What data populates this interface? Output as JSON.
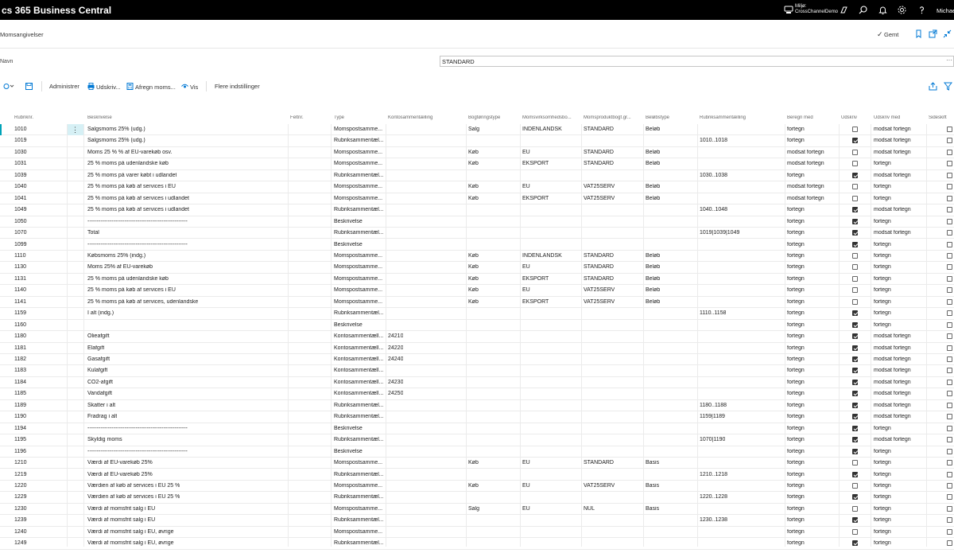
{
  "topbar": {
    "app_title": "cs 365 Business Central",
    "environment_label": "Miljø:",
    "environment_name": "CrossChannelDemo",
    "user_name": "Michae"
  },
  "page": {
    "title": "Momsangivelser",
    "saved_label": "Gemt",
    "name_label": "Navn",
    "name_value": "STANDARD"
  },
  "actions": {
    "administrer": "Administrer",
    "udskriv": "Udskriv...",
    "afregn_moms": "Afregn moms...",
    "vis": "Vis",
    "flere_indstillinger": "Flere indstillinger"
  },
  "columns": [
    "Rubriknr.",
    "Beskrivelse",
    "Feltnr.",
    "Type",
    "Kontosammentælling",
    "Bogføringstype",
    "Momsvirksomhedsbo...",
    "Momsproduktbogf.gr...",
    "Beløbstype",
    "Rubriksammentælling",
    "Beregn med",
    "Udskriv",
    "Udskriv med",
    "Sideskift"
  ],
  "rows": [
    {
      "nr": "1010",
      "desc": "Salgsmoms 25% (udg.)",
      "type": "Momspostsamme...",
      "konto": "",
      "bogf": "Salg",
      "virk": "INDENLANDSK",
      "prod": "STANDARD",
      "belob": "Beløb",
      "rubrik": "",
      "beregn": "fortegn",
      "udskriv": false,
      "udskrivmed": "modsat fortegn",
      "sideskift": false
    },
    {
      "nr": "1019",
      "desc": "Salgsmoms 25% (udg.)",
      "type": "Rubriksammentæl...",
      "konto": "",
      "bogf": "",
      "virk": "",
      "prod": "",
      "belob": "",
      "rubrik": "1010..1018",
      "beregn": "fortegn",
      "udskriv": true,
      "udskrivmed": "modsat fortegn",
      "sideskift": false
    },
    {
      "nr": "1030",
      "desc": "Moms 25 % % af EU-varekøb osv.",
      "type": "Momspostsamme...",
      "konto": "",
      "bogf": "Køb",
      "virk": "EU",
      "prod": "STANDARD",
      "belob": "Beløb",
      "rubrik": "",
      "beregn": "modsat fortegn",
      "udskriv": false,
      "udskrivmed": "modsat fortegn",
      "sideskift": false
    },
    {
      "nr": "1031",
      "desc": "25 % moms på udenlandske køb",
      "type": "Momspostsamme...",
      "konto": "",
      "bogf": "Køb",
      "virk": "EKSPORT",
      "prod": "STANDARD",
      "belob": "Beløb",
      "rubrik": "",
      "beregn": "modsat fortegn",
      "udskriv": false,
      "udskrivmed": "fortegn",
      "sideskift": false
    },
    {
      "nr": "1039",
      "desc": "25 % moms på varer købt i udlandet",
      "type": "Rubriksammentæl...",
      "konto": "",
      "bogf": "",
      "virk": "",
      "prod": "",
      "belob": "",
      "rubrik": "1030..1038",
      "beregn": "fortegn",
      "udskriv": true,
      "udskrivmed": "modsat fortegn",
      "sideskift": false
    },
    {
      "nr": "1040",
      "desc": "25 % moms på køb af services i EU",
      "type": "Momspostsamme...",
      "konto": "",
      "bogf": "Køb",
      "virk": "EU",
      "prod": "VAT25SERV",
      "belob": "Beløb",
      "rubrik": "",
      "beregn": "modsat fortegn",
      "udskriv": false,
      "udskrivmed": "fortegn",
      "sideskift": false
    },
    {
      "nr": "1041",
      "desc": "25 % moms på køb af services i udlandet",
      "type": "Momspostsamme...",
      "konto": "",
      "bogf": "Køb",
      "virk": "EKSPORT",
      "prod": "VAT25SERV",
      "belob": "Beløb",
      "rubrik": "",
      "beregn": "modsat fortegn",
      "udskriv": false,
      "udskrivmed": "fortegn",
      "sideskift": false
    },
    {
      "nr": "1049",
      "desc": "25 % moms på køb af services i udlandet",
      "type": "Rubriksammentæl...",
      "konto": "",
      "bogf": "",
      "virk": "",
      "prod": "",
      "belob": "",
      "rubrik": "1040..1048",
      "beregn": "fortegn",
      "udskriv": true,
      "udskrivmed": "modsat fortegn",
      "sideskift": false
    },
    {
      "nr": "1050",
      "desc": "------------------------------------------------------",
      "type": "Beskrivelse",
      "konto": "",
      "bogf": "",
      "virk": "",
      "prod": "",
      "belob": "",
      "rubrik": "",
      "beregn": "fortegn",
      "udskriv": true,
      "udskrivmed": "fortegn",
      "sideskift": false
    },
    {
      "nr": "1070",
      "desc": "Total",
      "type": "Rubriksammentæl...",
      "konto": "",
      "bogf": "",
      "virk": "",
      "prod": "",
      "belob": "",
      "rubrik": "1019|1039|1049",
      "beregn": "fortegn",
      "udskriv": true,
      "udskrivmed": "modsat fortegn",
      "sideskift": false
    },
    {
      "nr": "1099",
      "desc": "------------------------------------------------------",
      "type": "Beskrivelse",
      "konto": "",
      "bogf": "",
      "virk": "",
      "prod": "",
      "belob": "",
      "rubrik": "",
      "beregn": "fortegn",
      "udskriv": true,
      "udskrivmed": "fortegn",
      "sideskift": false
    },
    {
      "nr": "1110",
      "desc": "Købsmoms 25% (indg.)",
      "type": "Momspostsamme...",
      "konto": "",
      "bogf": "Køb",
      "virk": "INDENLANDSK",
      "prod": "STANDARD",
      "belob": "Beløb",
      "rubrik": "",
      "beregn": "fortegn",
      "udskriv": false,
      "udskrivmed": "fortegn",
      "sideskift": false
    },
    {
      "nr": "1130",
      "desc": "Moms 25% af EU-varekøb",
      "type": "Momspostsamme...",
      "konto": "",
      "bogf": "Køb",
      "virk": "EU",
      "prod": "STANDARD",
      "belob": "Beløb",
      "rubrik": "",
      "beregn": "fortegn",
      "udskriv": false,
      "udskrivmed": "fortegn",
      "sideskift": false
    },
    {
      "nr": "1131",
      "desc": "25 % moms på udenlandske køb",
      "type": "Momspostsamme...",
      "konto": "",
      "bogf": "Køb",
      "virk": "EKSPORT",
      "prod": "STANDARD",
      "belob": "Beløb",
      "rubrik": "",
      "beregn": "fortegn",
      "udskriv": false,
      "udskrivmed": "fortegn",
      "sideskift": false
    },
    {
      "nr": "1140",
      "desc": "25 % moms på køb af services i EU",
      "type": "Momspostsamme...",
      "konto": "",
      "bogf": "Køb",
      "virk": "EU",
      "prod": "VAT25SERV",
      "belob": "Beløb",
      "rubrik": "",
      "beregn": "fortegn",
      "udskriv": false,
      "udskrivmed": "fortegn",
      "sideskift": false
    },
    {
      "nr": "1141",
      "desc": "25 % moms på køb af services, udenlandske",
      "type": "Momspostsamme...",
      "konto": "",
      "bogf": "Køb",
      "virk": "EKSPORT",
      "prod": "VAT25SERV",
      "belob": "Beløb",
      "rubrik": "",
      "beregn": "fortegn",
      "udskriv": false,
      "udskrivmed": "fortegn",
      "sideskift": false
    },
    {
      "nr": "1159",
      "desc": "I alt (indg.)",
      "type": "Rubriksammentæl...",
      "konto": "",
      "bogf": "",
      "virk": "",
      "prod": "",
      "belob": "",
      "rubrik": "1110..1158",
      "beregn": "fortegn",
      "udskriv": true,
      "udskrivmed": "fortegn",
      "sideskift": false
    },
    {
      "nr": "1160",
      "desc": "",
      "type": "Beskrivelse",
      "konto": "",
      "bogf": "",
      "virk": "",
      "prod": "",
      "belob": "",
      "rubrik": "",
      "beregn": "fortegn",
      "udskriv": true,
      "udskrivmed": "fortegn",
      "sideskift": false
    },
    {
      "nr": "1180",
      "desc": "Olieafgift",
      "type": "Kontosammentæll...",
      "konto": "24210",
      "bogf": "",
      "virk": "",
      "prod": "",
      "belob": "",
      "rubrik": "",
      "beregn": "fortegn",
      "udskriv": true,
      "udskrivmed": "modsat fortegn",
      "sideskift": false
    },
    {
      "nr": "1181",
      "desc": "Elafgift",
      "type": "Kontosammentæll...",
      "konto": "24220",
      "bogf": "",
      "virk": "",
      "prod": "",
      "belob": "",
      "rubrik": "",
      "beregn": "fortegn",
      "udskriv": true,
      "udskrivmed": "modsat fortegn",
      "sideskift": false
    },
    {
      "nr": "1182",
      "desc": "Gasafgift",
      "type": "Kontosammentæll...",
      "konto": "24240",
      "bogf": "",
      "virk": "",
      "prod": "",
      "belob": "",
      "rubrik": "",
      "beregn": "fortegn",
      "udskriv": true,
      "udskrivmed": "modsat fortegn",
      "sideskift": false
    },
    {
      "nr": "1183",
      "desc": "Kulafgift",
      "type": "Kontosammentæll...",
      "konto": "",
      "bogf": "",
      "virk": "",
      "prod": "",
      "belob": "",
      "rubrik": "",
      "beregn": "fortegn",
      "udskriv": true,
      "udskrivmed": "modsat fortegn",
      "sideskift": false
    },
    {
      "nr": "1184",
      "desc": "CO2-afgift",
      "type": "Kontosammentæll...",
      "konto": "24230",
      "bogf": "",
      "virk": "",
      "prod": "",
      "belob": "",
      "rubrik": "",
      "beregn": "fortegn",
      "udskriv": true,
      "udskrivmed": "modsat fortegn",
      "sideskift": false
    },
    {
      "nr": "1185",
      "desc": "Vandafgift",
      "type": "Kontosammentæll...",
      "konto": "24250",
      "bogf": "",
      "virk": "",
      "prod": "",
      "belob": "",
      "rubrik": "",
      "beregn": "fortegn",
      "udskriv": true,
      "udskrivmed": "modsat fortegn",
      "sideskift": false
    },
    {
      "nr": "1189",
      "desc": "Skatter i alt",
      "type": "Rubriksammentæl...",
      "konto": "",
      "bogf": "",
      "virk": "",
      "prod": "",
      "belob": "",
      "rubrik": "1180..1188",
      "beregn": "fortegn",
      "udskriv": true,
      "udskrivmed": "modsat fortegn",
      "sideskift": false
    },
    {
      "nr": "1190",
      "desc": "Fradrag i alt",
      "type": "Rubriksammentæl...",
      "konto": "",
      "bogf": "",
      "virk": "",
      "prod": "",
      "belob": "",
      "rubrik": "1159|1189",
      "beregn": "fortegn",
      "udskriv": true,
      "udskrivmed": "modsat fortegn",
      "sideskift": false
    },
    {
      "nr": "1194",
      "desc": "------------------------------------------------------",
      "type": "Beskrivelse",
      "konto": "",
      "bogf": "",
      "virk": "",
      "prod": "",
      "belob": "",
      "rubrik": "",
      "beregn": "fortegn",
      "udskriv": true,
      "udskrivmed": "fortegn",
      "sideskift": false
    },
    {
      "nr": "1195",
      "desc": "Skyldig moms",
      "type": "Rubriksammentæl...",
      "konto": "",
      "bogf": "",
      "virk": "",
      "prod": "",
      "belob": "",
      "rubrik": "1070|1190",
      "beregn": "fortegn",
      "udskriv": true,
      "udskrivmed": "modsat fortegn",
      "sideskift": false
    },
    {
      "nr": "1196",
      "desc": "------------------------------------------------------",
      "type": "Beskrivelse",
      "konto": "",
      "bogf": "",
      "virk": "",
      "prod": "",
      "belob": "",
      "rubrik": "",
      "beregn": "fortegn",
      "udskriv": true,
      "udskrivmed": "fortegn",
      "sideskift": false
    },
    {
      "nr": "1210",
      "desc": "Værdi af EU-varekøb 25%",
      "type": "Momspostsamme...",
      "konto": "",
      "bogf": "Køb",
      "virk": "EU",
      "prod": "STANDARD",
      "belob": "Basis",
      "rubrik": "",
      "beregn": "fortegn",
      "udskriv": false,
      "udskrivmed": "fortegn",
      "sideskift": false
    },
    {
      "nr": "1219",
      "desc": "Værdi af EU-varekøb 25%",
      "type": "Rubriksammentæl...",
      "konto": "",
      "bogf": "",
      "virk": "",
      "prod": "",
      "belob": "",
      "rubrik": "1210..1218",
      "beregn": "fortegn",
      "udskriv": true,
      "udskrivmed": "fortegn",
      "sideskift": false
    },
    {
      "nr": "1220",
      "desc": "Værdien af køb af services i EU 25 %",
      "type": "Momspostsamme...",
      "konto": "",
      "bogf": "Køb",
      "virk": "EU",
      "prod": "VAT25SERV",
      "belob": "Basis",
      "rubrik": "",
      "beregn": "fortegn",
      "udskriv": false,
      "udskrivmed": "fortegn",
      "sideskift": false
    },
    {
      "nr": "1229",
      "desc": "Værdien af køb af services i EU 25 %",
      "type": "Rubriksammentæl...",
      "konto": "",
      "bogf": "",
      "virk": "",
      "prod": "",
      "belob": "",
      "rubrik": "1220..1228",
      "beregn": "fortegn",
      "udskriv": true,
      "udskrivmed": "fortegn",
      "sideskift": false
    },
    {
      "nr": "1230",
      "desc": "Værdi af momsfrit salg i EU",
      "type": "Momspostsamme...",
      "konto": "",
      "bogf": "Salg",
      "virk": "EU",
      "prod": "NUL",
      "belob": "Basis",
      "rubrik": "",
      "beregn": "fortegn",
      "udskriv": false,
      "udskrivmed": "fortegn",
      "sideskift": false
    },
    {
      "nr": "1239",
      "desc": "Værdi af momsfrit salg i EU",
      "type": "Rubriksammentæl...",
      "konto": "",
      "bogf": "",
      "virk": "",
      "prod": "",
      "belob": "",
      "rubrik": "1230..1238",
      "beregn": "fortegn",
      "udskriv": true,
      "udskrivmed": "fortegn",
      "sideskift": false
    },
    {
      "nr": "1240",
      "desc": "Værdi af momsfrit salg i EU, øvrige",
      "type": "Momspostsamme...",
      "konto": "",
      "bogf": "",
      "virk": "",
      "prod": "",
      "belob": "",
      "rubrik": "",
      "beregn": "fortegn",
      "udskriv": false,
      "udskrivmed": "fortegn",
      "sideskift": false
    },
    {
      "nr": "1249",
      "desc": "Værdi af momsfrit salg i EU, øvrige",
      "type": "Rubriksammentæl...",
      "konto": "",
      "bogf": "",
      "virk": "",
      "prod": "",
      "belob": "",
      "rubrik": "",
      "beregn": "fortegn",
      "udskriv": true,
      "udskrivmed": "fortegn",
      "sideskift": false
    }
  ],
  "colors": {
    "accent": "#00a3b8",
    "selected_cell": "#d6f0f5",
    "topbar": "#000000"
  },
  "icons": [
    "environment-icon",
    "copilot-icon",
    "search-icon",
    "bell-icon",
    "gear-icon",
    "help-icon",
    "bookmark-icon",
    "open-in-new-icon",
    "collapse-icon",
    "share-icon",
    "filter-icon",
    "print-icon",
    "calculator-icon",
    "eye-icon"
  ]
}
